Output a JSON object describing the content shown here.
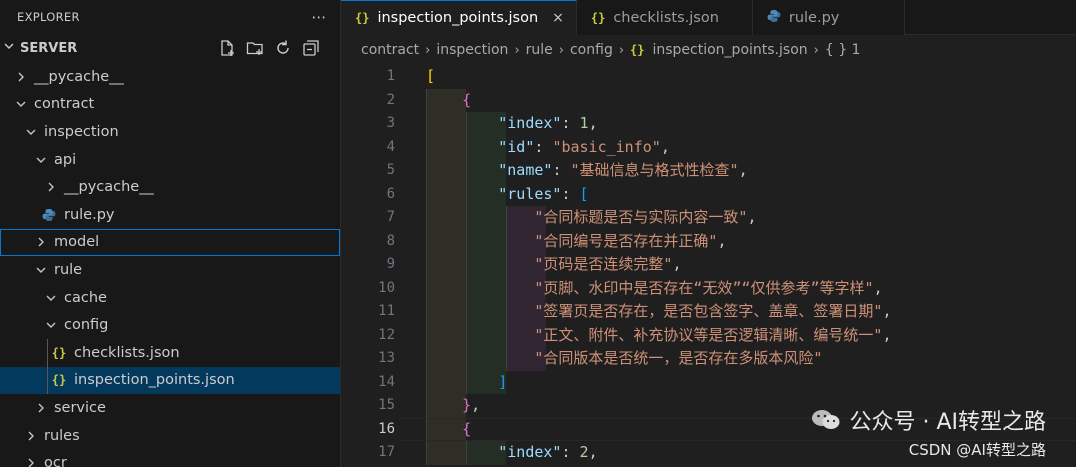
{
  "explorer": {
    "title": "EXPLORER",
    "more_icon": "ellipsis-icon",
    "root": "SERVER",
    "root_actions": [
      "new-file-icon",
      "new-folder-icon",
      "refresh-icon",
      "collapse-all-icon"
    ],
    "tree": [
      {
        "label": "__pycache__",
        "depth": 1,
        "type": "folder",
        "expanded": false
      },
      {
        "label": "contract",
        "depth": 1,
        "type": "folder",
        "expanded": true
      },
      {
        "label": "inspection",
        "depth": 2,
        "type": "folder",
        "expanded": true
      },
      {
        "label": "api",
        "depth": 3,
        "type": "folder",
        "expanded": true
      },
      {
        "label": "__pycache__",
        "depth": 4,
        "type": "folder",
        "expanded": false
      },
      {
        "label": "rule.py",
        "depth": 4,
        "type": "python"
      },
      {
        "label": "model",
        "depth": 3,
        "type": "folder",
        "expanded": false,
        "focused": true
      },
      {
        "label": "rule",
        "depth": 3,
        "type": "folder",
        "expanded": true
      },
      {
        "label": "cache",
        "depth": 4,
        "type": "folder",
        "expanded": true
      },
      {
        "label": "config",
        "depth": 4,
        "type": "folder",
        "expanded": true
      },
      {
        "label": "checklists.json",
        "depth": 5,
        "type": "json"
      },
      {
        "label": "inspection_points.json",
        "depth": 5,
        "type": "json",
        "selected": true
      },
      {
        "label": "service",
        "depth": 3,
        "type": "folder",
        "expanded": false
      },
      {
        "label": "rules",
        "depth": 2,
        "type": "folder",
        "expanded": false
      },
      {
        "label": "ocr",
        "depth": 2,
        "type": "folder",
        "expanded": false
      }
    ]
  },
  "tabs": [
    {
      "label": "inspection_points.json",
      "icon": "json-braces-icon",
      "active": true,
      "close": "×"
    },
    {
      "label": "checklists.json",
      "icon": "json-braces-icon",
      "active": false
    },
    {
      "label": "rule.py",
      "icon": "python-icon",
      "active": false
    }
  ],
  "breadcrumb": {
    "parts": [
      "contract",
      "inspection",
      "rule",
      "config"
    ],
    "file": "inspection_points.json",
    "symbol": "{ } 1"
  },
  "editor": {
    "current_line": 16,
    "lines": [
      {
        "n": "1",
        "tokens": [
          [
            "b1",
            "["
          ]
        ]
      },
      {
        "n": "2",
        "tokens": [
          [
            "p",
            "    "
          ],
          [
            "b2",
            "{"
          ]
        ]
      },
      {
        "n": "3",
        "tokens": [
          [
            "p",
            "        "
          ],
          [
            "k",
            "\"index\""
          ],
          [
            "p",
            ": "
          ],
          [
            "n",
            "1"
          ],
          [
            "p",
            ","
          ]
        ]
      },
      {
        "n": "4",
        "tokens": [
          [
            "p",
            "        "
          ],
          [
            "k",
            "\"id\""
          ],
          [
            "p",
            ": "
          ],
          [
            "s",
            "\"basic_info\""
          ],
          [
            "p",
            ","
          ]
        ]
      },
      {
        "n": "5",
        "tokens": [
          [
            "p",
            "        "
          ],
          [
            "k",
            "\"name\""
          ],
          [
            "p",
            ": "
          ],
          [
            "s",
            "\"基础信息与格式性检查\""
          ],
          [
            "p",
            ","
          ]
        ]
      },
      {
        "n": "6",
        "tokens": [
          [
            "p",
            "        "
          ],
          [
            "k",
            "\"rules\""
          ],
          [
            "p",
            ": "
          ],
          [
            "b3",
            "["
          ]
        ]
      },
      {
        "n": "7",
        "tokens": [
          [
            "p",
            "            "
          ],
          [
            "s",
            "\"合同标题是否与实际内容一致\""
          ],
          [
            "p",
            ","
          ]
        ]
      },
      {
        "n": "8",
        "tokens": [
          [
            "p",
            "            "
          ],
          [
            "s",
            "\"合同编号是否存在并正确\""
          ],
          [
            "p",
            ","
          ]
        ]
      },
      {
        "n": "9",
        "tokens": [
          [
            "p",
            "            "
          ],
          [
            "s",
            "\"页码是否连续完整\""
          ],
          [
            "p",
            ","
          ]
        ]
      },
      {
        "n": "10",
        "tokens": [
          [
            "p",
            "            "
          ],
          [
            "s",
            "\"页脚、水印中是否存在“无效”“仅供参考”等字样\""
          ],
          [
            "p",
            ","
          ]
        ]
      },
      {
        "n": "11",
        "tokens": [
          [
            "p",
            "            "
          ],
          [
            "s",
            "\"签署页是否存在，是否包含签字、盖章、签署日期\""
          ],
          [
            "p",
            ","
          ]
        ]
      },
      {
        "n": "12",
        "tokens": [
          [
            "p",
            "            "
          ],
          [
            "s",
            "\"正文、附件、补充协议等是否逻辑清晰、编号统一\""
          ],
          [
            "p",
            ","
          ]
        ]
      },
      {
        "n": "13",
        "tokens": [
          [
            "p",
            "            "
          ],
          [
            "s",
            "\"合同版本是否统一，是否存在多版本风险\""
          ]
        ]
      },
      {
        "n": "14",
        "tokens": [
          [
            "p",
            "        "
          ],
          [
            "b3",
            "]"
          ]
        ]
      },
      {
        "n": "15",
        "tokens": [
          [
            "p",
            "    "
          ],
          [
            "b2",
            "}"
          ],
          [
            "p",
            ","
          ]
        ]
      },
      {
        "n": "16",
        "tokens": [
          [
            "p",
            "    "
          ],
          [
            "b2",
            "{"
          ]
        ]
      },
      {
        "n": "17",
        "tokens": [
          [
            "p",
            "        "
          ],
          [
            "k",
            "\"index\""
          ],
          [
            "p",
            ": "
          ],
          [
            "n",
            "2"
          ],
          [
            "p",
            ","
          ]
        ]
      }
    ]
  },
  "watermark": {
    "main": "公众号 · AI转型之路",
    "sub": "CSDN @AI转型之路",
    "logo_icon": "wechat-icon"
  },
  "colors": {
    "accent": "#0078d4",
    "selection": "#04395e",
    "json_icon": "#cbcb41",
    "python_icon": "#4b8bbe"
  }
}
